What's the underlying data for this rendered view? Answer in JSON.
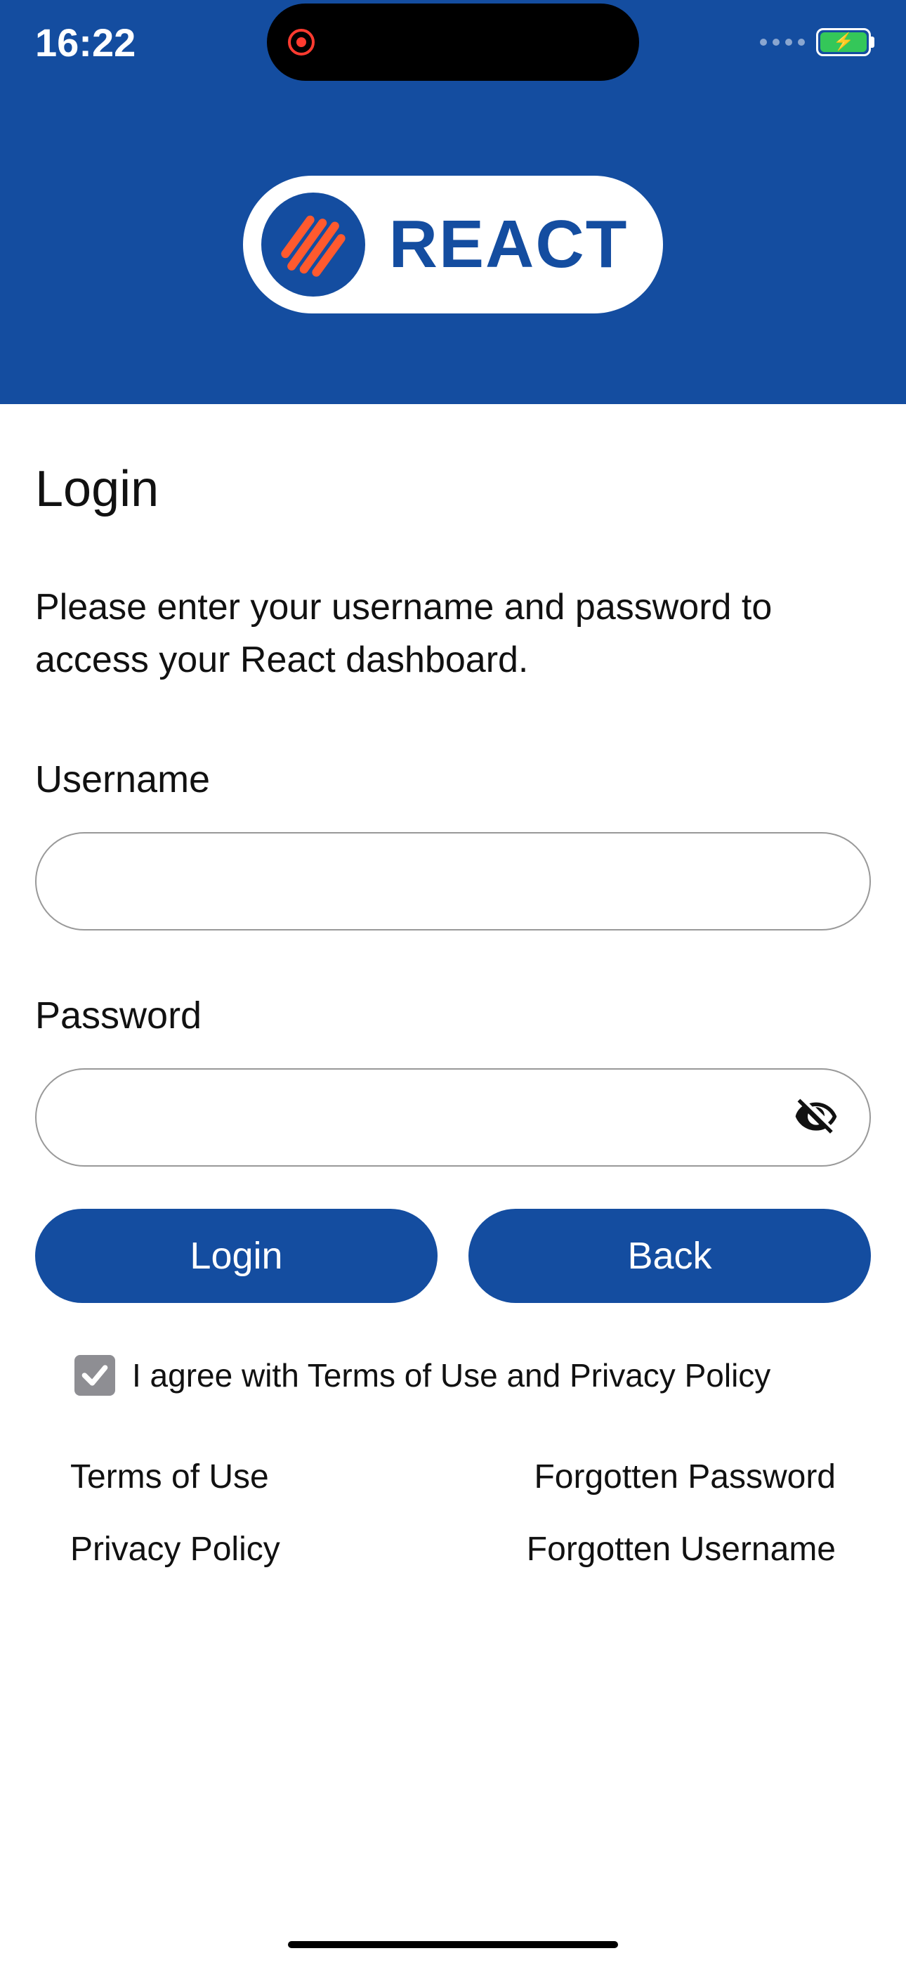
{
  "status": {
    "time": "16:22"
  },
  "brand": {
    "name": "REACT"
  },
  "login": {
    "title": "Login",
    "description": "Please enter your username and password to access your React dashboard.",
    "username_label": "Username",
    "username_value": "",
    "password_label": "Password",
    "password_value": "",
    "login_button": "Login",
    "back_button": "Back",
    "agree_text": "I agree with Terms of Use and Privacy Policy",
    "agree_checked": true
  },
  "links": {
    "terms": "Terms of Use",
    "privacy": "Privacy Policy",
    "forgot_password": "Forgotten Password",
    "forgot_username": "Forgotten Username"
  },
  "colors": {
    "brand_blue": "#144da0",
    "accent_orange": "#ff5a2e",
    "battery_green": "#34c759"
  }
}
